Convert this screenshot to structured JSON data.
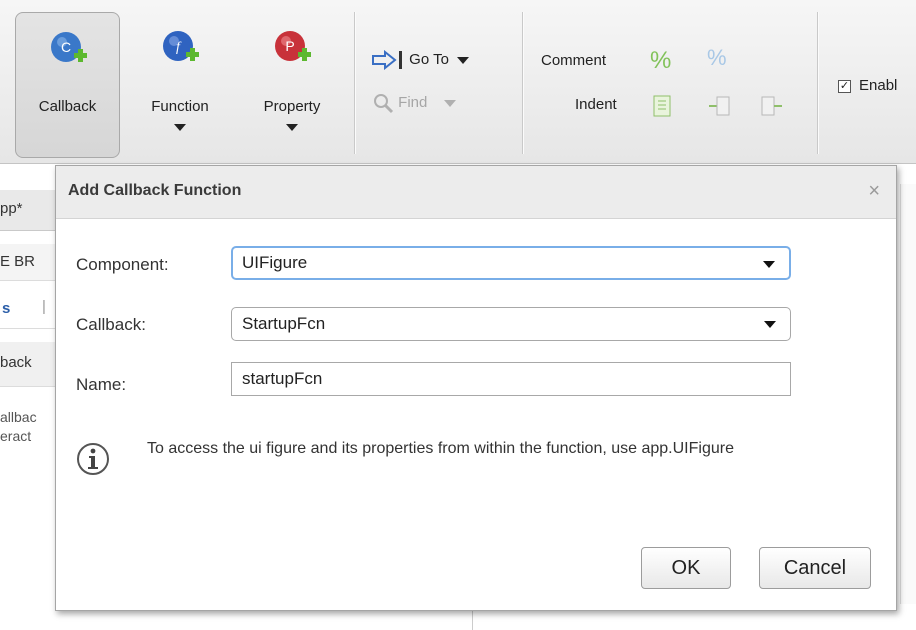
{
  "toolbar": {
    "callback_label": "Callback",
    "function_label": "Function",
    "property_label": "Property",
    "goto_label": "Go To",
    "find_label": "Find",
    "comment_label": "Comment",
    "indent_label": "Indent",
    "enable_label": "Enabl"
  },
  "background_fragments": {
    "tab_label": "pp*",
    "line1": "E BR",
    "line2": "s",
    "line3": "back",
    "line4": "allbac",
    "line5": "eract"
  },
  "dialog": {
    "title": "Add Callback Function",
    "component_label": "Component:",
    "component_value": "UIFigure",
    "callback_label": "Callback:",
    "callback_value": "StartupFcn",
    "name_label": "Name:",
    "name_value": "startupFcn",
    "message": "To access the ui figure and its properties from within the function, use app.UIFigure",
    "ok_label": "OK",
    "cancel_label": "Cancel",
    "close_glyph": "×"
  },
  "colors": {
    "callback_icon": "#3a78c9",
    "function_icon": "#2f63c0",
    "property_icon": "#c8323a",
    "plus_badge": "#5cb82f",
    "focus_border": "#79aee8"
  }
}
